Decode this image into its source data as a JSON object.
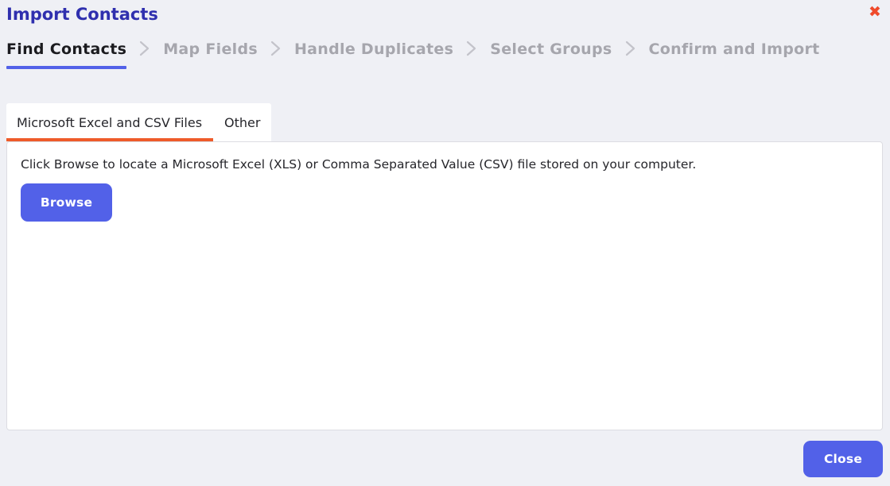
{
  "dialog": {
    "title": "Import Contacts",
    "close_icon": "close-icon",
    "close_icon_glyph": "✖",
    "close_icon_color": "#ef4a2b"
  },
  "stepper": {
    "separator_icon": "chevron-right-icon",
    "active_underline_color": "#5261e8",
    "steps": [
      {
        "label": "Find Contacts",
        "active": true
      },
      {
        "label": "Map Fields",
        "active": false
      },
      {
        "label": "Handle Duplicates",
        "active": false
      },
      {
        "label": "Select Groups",
        "active": false
      },
      {
        "label": "Confirm and Import",
        "active": false
      }
    ]
  },
  "tabs": {
    "active_indicator_color": "#ee5b2a",
    "items": [
      {
        "label": "Microsoft Excel and CSV Files",
        "active": true
      },
      {
        "label": "Other",
        "active": false
      }
    ]
  },
  "panel": {
    "description": "Click Browse to locate a Microsoft Excel (XLS) or Comma Separated Value (CSV) file stored on your computer.",
    "browse_label": "Browse"
  },
  "footer": {
    "close_label": "Close",
    "button_color": "#5261e8"
  }
}
